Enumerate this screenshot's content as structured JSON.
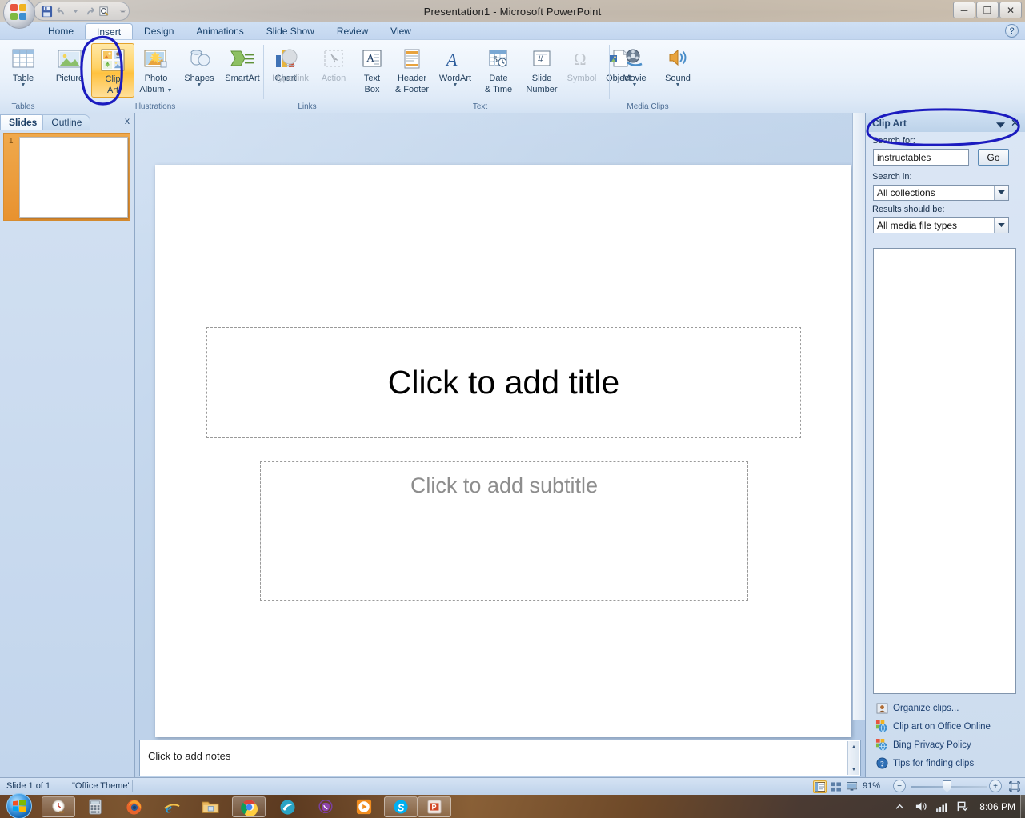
{
  "window": {
    "title": "Presentation1 - Microsoft PowerPoint",
    "minimize_label": "─",
    "restore_label": "❐",
    "close_label": "✕",
    "help_label": "?"
  },
  "quick_access": {
    "items": [
      {
        "name": "save",
        "label": "Save"
      },
      {
        "name": "undo",
        "label": "Undo"
      },
      {
        "name": "redo",
        "label": "Redo"
      },
      {
        "name": "print-preview",
        "label": "Print Preview"
      },
      {
        "name": "customize",
        "label": "Customize Quick Access Toolbar"
      }
    ]
  },
  "ribbon": {
    "tabs": [
      {
        "label": "Home",
        "active": false
      },
      {
        "label": "Insert",
        "active": true
      },
      {
        "label": "Design",
        "active": false
      },
      {
        "label": "Animations",
        "active": false
      },
      {
        "label": "Slide Show",
        "active": false
      },
      {
        "label": "Review",
        "active": false
      },
      {
        "label": "View",
        "active": false
      }
    ],
    "groups": [
      {
        "title": "Tables",
        "buttons": [
          {
            "label_line1": "Table",
            "label_line2": "",
            "arrow": true,
            "disabled": false,
            "selected": false
          }
        ]
      },
      {
        "title": "Illustrations",
        "buttons": [
          {
            "label_line1": "Picture",
            "label_line2": "",
            "arrow": false,
            "disabled": false,
            "selected": false
          },
          {
            "label_line1": "Clip",
            "label_line2": "Art",
            "arrow": false,
            "disabled": false,
            "selected": true
          },
          {
            "label_line1": "Photo",
            "label_line2": "Album",
            "arrow": true,
            "disabled": false,
            "selected": false
          },
          {
            "label_line1": "Shapes",
            "label_line2": "",
            "arrow": true,
            "disabled": false,
            "selected": false
          },
          {
            "label_line1": "SmartArt",
            "label_line2": "",
            "arrow": false,
            "disabled": false,
            "selected": false
          },
          {
            "label_line1": "Chart",
            "label_line2": "",
            "arrow": false,
            "disabled": false,
            "selected": false
          }
        ]
      },
      {
        "title": "Links",
        "buttons": [
          {
            "label_line1": "Hyperlink",
            "label_line2": "",
            "arrow": false,
            "disabled": true,
            "selected": false
          },
          {
            "label_line1": "Action",
            "label_line2": "",
            "arrow": false,
            "disabled": true,
            "selected": false
          }
        ]
      },
      {
        "title": "Text",
        "buttons": [
          {
            "label_line1": "Text",
            "label_line2": "Box",
            "arrow": false,
            "disabled": false,
            "selected": false
          },
          {
            "label_line1": "Header",
            "label_line2": "& Footer",
            "arrow": false,
            "disabled": false,
            "selected": false
          },
          {
            "label_line1": "WordArt",
            "label_line2": "",
            "arrow": true,
            "disabled": false,
            "selected": false
          },
          {
            "label_line1": "Date",
            "label_line2": "& Time",
            "arrow": false,
            "disabled": false,
            "selected": false
          },
          {
            "label_line1": "Slide",
            "label_line2": "Number",
            "arrow": false,
            "disabled": false,
            "selected": false
          },
          {
            "label_line1": "Symbol",
            "label_line2": "",
            "arrow": false,
            "disabled": true,
            "selected": false
          },
          {
            "label_line1": "Object",
            "label_line2": "",
            "arrow": false,
            "disabled": false,
            "selected": false
          }
        ]
      },
      {
        "title": "Media Clips",
        "buttons": [
          {
            "label_line1": "Movie",
            "label_line2": "",
            "arrow": true,
            "disabled": false,
            "selected": false
          },
          {
            "label_line1": "Sound",
            "label_line2": "",
            "arrow": true,
            "disabled": false,
            "selected": false
          }
        ]
      }
    ]
  },
  "left_pane": {
    "tabs": [
      {
        "label": "Slides",
        "active": true
      },
      {
        "label": "Outline",
        "active": false
      }
    ],
    "close_label": "x",
    "slide_number": "1"
  },
  "slide": {
    "title_placeholder": "Click to add title",
    "subtitle_placeholder": "Click to add subtitle",
    "notes_placeholder": "Click to add notes"
  },
  "task_pane": {
    "title": "Clip Art",
    "close_label": "✕",
    "search_for_label": "Search for:",
    "search_value": "instructables",
    "go_label": "Go",
    "search_in_label": "Search in:",
    "search_in_value": "All collections",
    "results_label": "Results should be:",
    "results_value": "All media file types",
    "links": [
      {
        "icon": "organize-clips-icon",
        "label": "Organize clips..."
      },
      {
        "icon": "office-online-icon",
        "label": "Clip art on Office Online"
      },
      {
        "icon": "bing-privacy-icon",
        "label": "Bing Privacy Policy"
      },
      {
        "icon": "help-tips-icon",
        "label": "Tips for finding clips"
      }
    ]
  },
  "status_bar": {
    "slide_count": "Slide 1 of 1",
    "theme": "\"Office Theme\"",
    "zoom": "91%",
    "zoom_out_label": "−",
    "zoom_in_label": "+",
    "views": [
      {
        "name": "normal-view",
        "active": true
      },
      {
        "name": "slide-sorter-view",
        "active": false
      },
      {
        "name": "slide-show-view",
        "active": false
      }
    ]
  },
  "taskbar": {
    "start_label": "Start",
    "items": [
      {
        "name": "clock-app",
        "active": true
      },
      {
        "name": "calculator",
        "active": false
      },
      {
        "name": "firefox",
        "active": false
      },
      {
        "name": "internet-explorer",
        "active": false
      },
      {
        "name": "windows-explorer",
        "active": false
      },
      {
        "name": "google-chrome",
        "active": true
      },
      {
        "name": "maxthon-browser",
        "active": false
      },
      {
        "name": "viber",
        "active": false
      },
      {
        "name": "media-player",
        "active": false
      },
      {
        "name": "skype",
        "active": true
      },
      {
        "name": "powerpoint",
        "active": true
      }
    ],
    "clock": "8:06 PM"
  },
  "colors": {
    "accent": "#1f4e85",
    "annotation": "#1b1bbf",
    "selection": "#ffc23f"
  }
}
